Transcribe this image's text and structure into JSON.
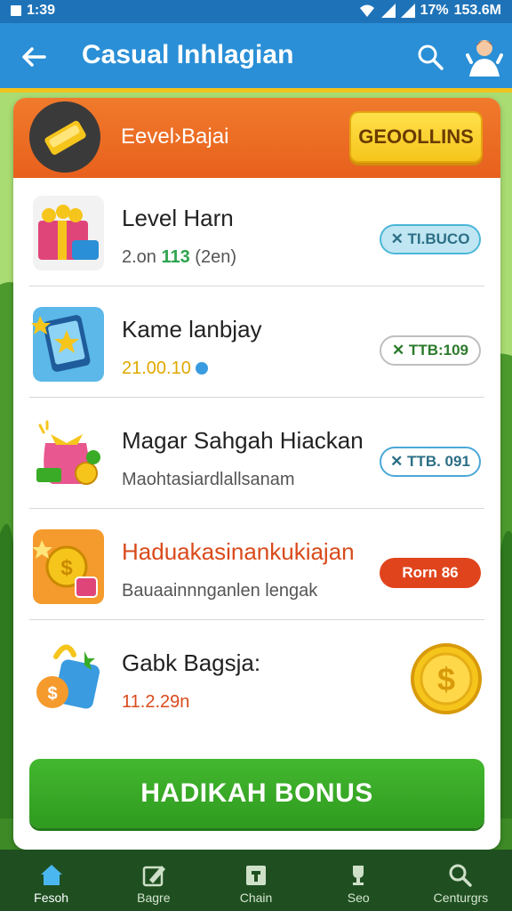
{
  "status_bar": {
    "time": "1:39",
    "signal": "17%",
    "data_rate": "153.6M"
  },
  "app_bar": {
    "title": "Casual Inhlagian"
  },
  "header": {
    "title": "Eevel›Bajai",
    "button_label": "GEOOLLINS"
  },
  "items": [
    {
      "name": "Level Harn",
      "sub_prefix": "2.on ",
      "sub_highlight": "113",
      "sub_suffix": " (2en)",
      "badge": "✕ TI.BUCO",
      "badge_style": "blue-filled",
      "icon": "gift-box-icon"
    },
    {
      "name": "Kame lanbjay",
      "sub": "21.00.10",
      "badge": "✕ TTB:109",
      "badge_style": "green-outline",
      "icon": "tablet-star-icon"
    },
    {
      "name": "Magar Sahgah Hiackan",
      "sub": "Maohtasiardlallsanam",
      "badge": "✕ TTB. 091",
      "badge_style": "blue-outline",
      "icon": "money-bag-icon"
    },
    {
      "name": "Haduakasinankukiajan",
      "sub": "Bauaainnnganlen lengak",
      "badge": "Rorn 86",
      "badge_style": "red-filled",
      "icon": "coins-icon"
    },
    {
      "name": "Gabk Bagsja:",
      "sub": "11.2.29n",
      "icon": "cash-stack-icon",
      "reward": "gold-coin-icon"
    }
  ],
  "cta": {
    "label": "HADIKAH BONUS"
  },
  "bottom_nav": [
    {
      "label": "Fesoh",
      "icon": "home-icon",
      "active": true
    },
    {
      "label": "Bagre",
      "icon": "edit-icon",
      "active": false
    },
    {
      "label": "Chain",
      "icon": "store-icon",
      "active": false
    },
    {
      "label": "Seo",
      "icon": "trophy-icon",
      "active": false
    },
    {
      "label": "Centurgrs",
      "icon": "search-icon",
      "active": false
    }
  ],
  "colors": {
    "appbar": "#2a8fd6",
    "header": "#e8611d",
    "cta": "#3aab27",
    "accent_gold": "#f6c51c",
    "nav": "#1f4f21"
  }
}
